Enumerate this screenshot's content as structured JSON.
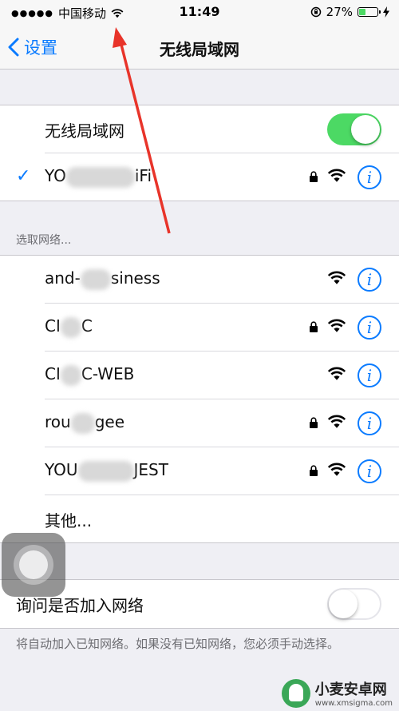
{
  "status_bar": {
    "signal": "●●●●●",
    "carrier": "中国移动",
    "time": "11:49",
    "battery_percent": "27%"
  },
  "nav": {
    "back_label": "设置",
    "title": "无线局域网"
  },
  "wifi_toggle": {
    "label": "无线局域网",
    "on": true
  },
  "connected_network": {
    "name_prefix": "YO",
    "name_suffix": "iFi",
    "secured": true
  },
  "section_header": "选取网络...",
  "networks": [
    {
      "name_prefix": "and-",
      "name_suffix": "siness",
      "secured": false
    },
    {
      "name_prefix": "CI",
      "name_suffix": "C",
      "secured": true
    },
    {
      "name_prefix": "CI",
      "name_suffix": "C-WEB",
      "secured": false
    },
    {
      "name_prefix": "rou",
      "name_suffix": "gee",
      "secured": true
    },
    {
      "name_prefix": "YOU",
      "name_suffix": "JEST",
      "secured": true
    }
  ],
  "other_label": "其他...",
  "ask_to_join": {
    "label": "询问是否加入网络",
    "on": false
  },
  "footer_note": "将自动加入已知网络。如果没有已知网络，您必须手动选择。",
  "watermark": {
    "title": "小麦安卓网",
    "url": "www.xmsigma.com"
  },
  "colors": {
    "accent": "#0a7bff",
    "toggle_on": "#4cd964",
    "background": "#efeff4"
  },
  "icons": [
    "chevron-left-icon",
    "wifi-icon",
    "lock-icon",
    "info-icon",
    "check-icon"
  ]
}
